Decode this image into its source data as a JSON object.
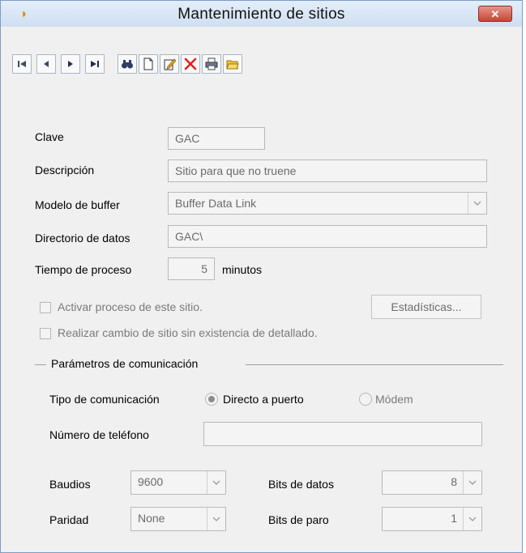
{
  "window": {
    "title": "Mantenimiento de sitios",
    "close_label": "✕"
  },
  "toolbar": {
    "buttons": [
      "first-record",
      "previous-record",
      "next-record",
      "last-record",
      "search",
      "new",
      "edit",
      "delete",
      "print",
      "open"
    ]
  },
  "form": {
    "clave": {
      "label": "Clave",
      "value": "GAC"
    },
    "descripcion": {
      "label": "Descripción",
      "value": "Sitio para que no truene"
    },
    "modelo_buffer": {
      "label": "Modelo de buffer",
      "value": "Buffer Data Link"
    },
    "directorio": {
      "label": "Directorio de datos",
      "value": "GAC\\"
    },
    "tiempo": {
      "label": "Tiempo de proceso",
      "value": "5",
      "unit": "minutos"
    },
    "activar": {
      "label": "Activar proceso de este sitio.",
      "checked": false
    },
    "estadisticas_button": "Estadísticas...",
    "realizar": {
      "label": "Realizar cambio de sitio sin existencia de detallado.",
      "checked": false
    }
  },
  "comunicacion": {
    "group_title": "Parámetros de comunicación",
    "tipo_label": "Tipo de comunicación",
    "opt_directo": "Directo a puerto",
    "opt_modem": "Módem",
    "selected": "Directo a puerto",
    "telefono_label": "Número de teléfono",
    "telefono_value": "",
    "baudios_label": "Baudios",
    "baudios_value": "9600",
    "paridad_label": "Paridad",
    "paridad_value": "None",
    "bits_datos_label": "Bits de datos",
    "bits_datos_value": "8",
    "bits_paro_label": "Bits de paro",
    "bits_paro_value": "1"
  }
}
